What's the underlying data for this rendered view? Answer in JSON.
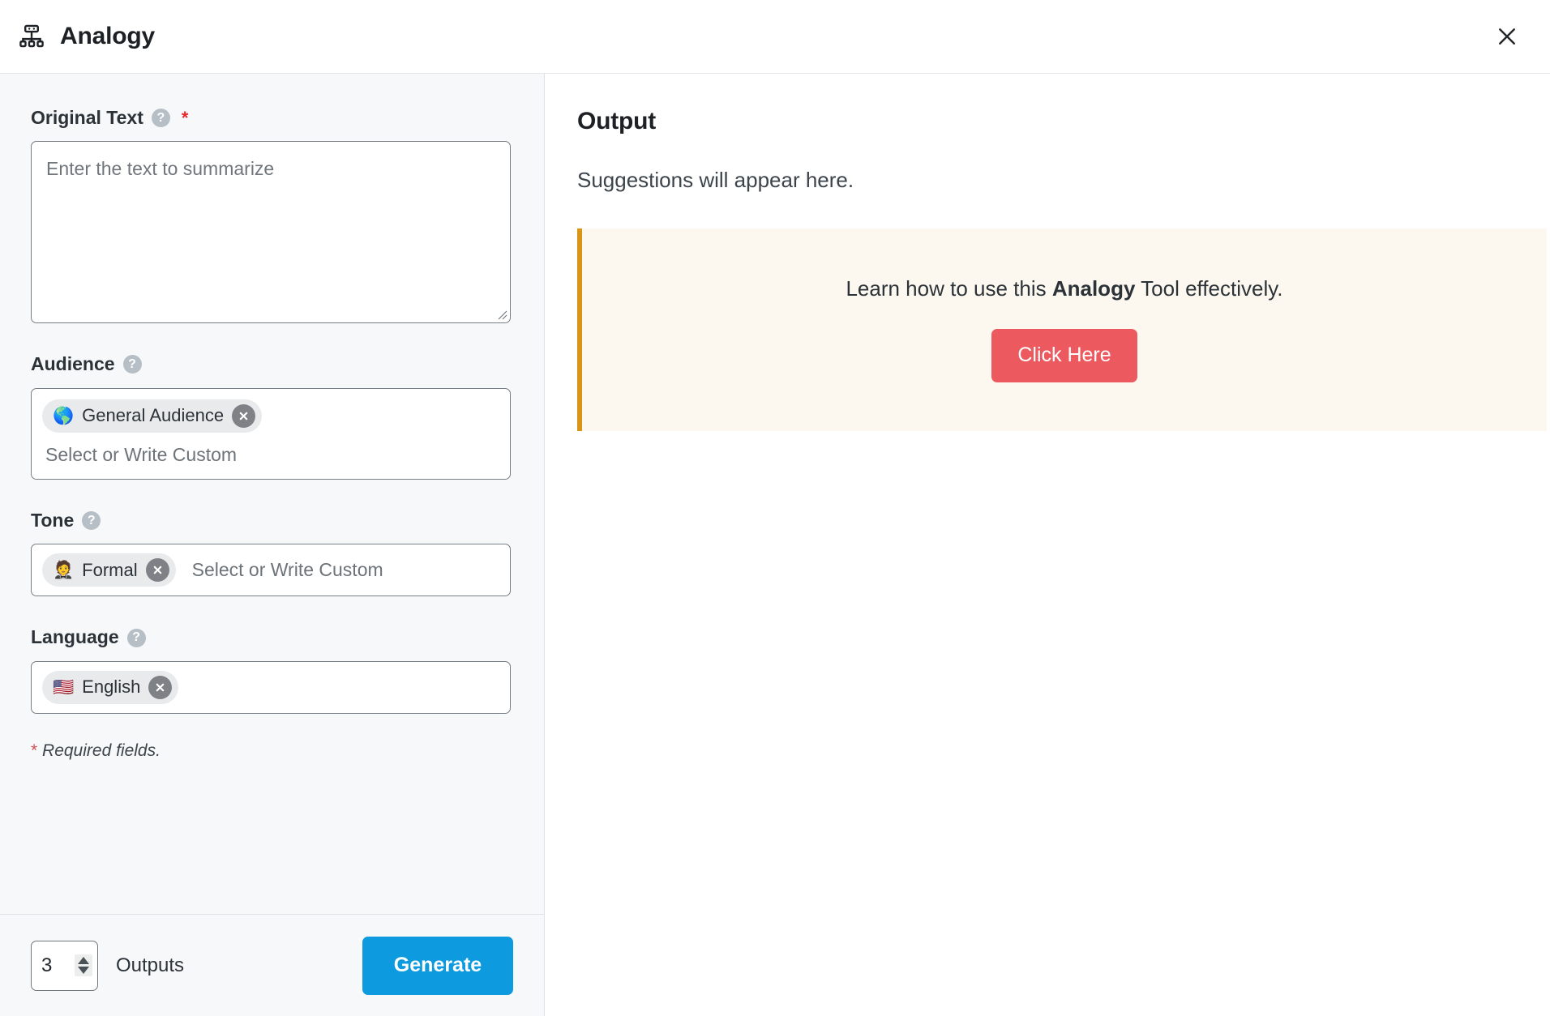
{
  "window": {
    "title": "Analogy",
    "icon": "sitemap-icon",
    "close_icon": "close-icon"
  },
  "form": {
    "original_text": {
      "label": "Original Text",
      "help_icon": "help-icon",
      "required_marker": "*",
      "placeholder": "Enter the text to summarize",
      "value": ""
    },
    "audience": {
      "label": "Audience",
      "help_icon": "help-icon",
      "chips": [
        {
          "emoji": "🌎",
          "label": "General Audience",
          "remove_icon": "close-icon"
        }
      ],
      "placeholder": "Select or Write Custom"
    },
    "tone": {
      "label": "Tone",
      "help_icon": "help-icon",
      "chips": [
        {
          "emoji": "🤵",
          "label": "Formal",
          "remove_icon": "close-icon"
        }
      ],
      "placeholder": "Select or Write Custom"
    },
    "language": {
      "label": "Language",
      "help_icon": "help-icon",
      "chips": [
        {
          "emoji": "🇺🇸",
          "label": "English",
          "remove_icon": "close-icon"
        }
      ],
      "placeholder": ""
    },
    "required_note_star": "*",
    "required_note": "Required fields."
  },
  "action_bar": {
    "outputs_count": "3",
    "outputs_label": "Outputs",
    "generate_label": "Generate"
  },
  "output": {
    "title": "Output",
    "empty_message": "Suggestions will appear here.",
    "promo": {
      "text_before": "Learn how to use this ",
      "text_bold": "Analogy",
      "text_after": " Tool effectively.",
      "button_label": "Click Here"
    }
  },
  "colors": {
    "accent_blue": "#0d9adf",
    "promo_red": "#ec5a5f",
    "promo_bg": "#fdf8ef",
    "promo_border": "#d99516",
    "required_red": "#e8262b",
    "panel_bg": "#f7f8fa"
  }
}
